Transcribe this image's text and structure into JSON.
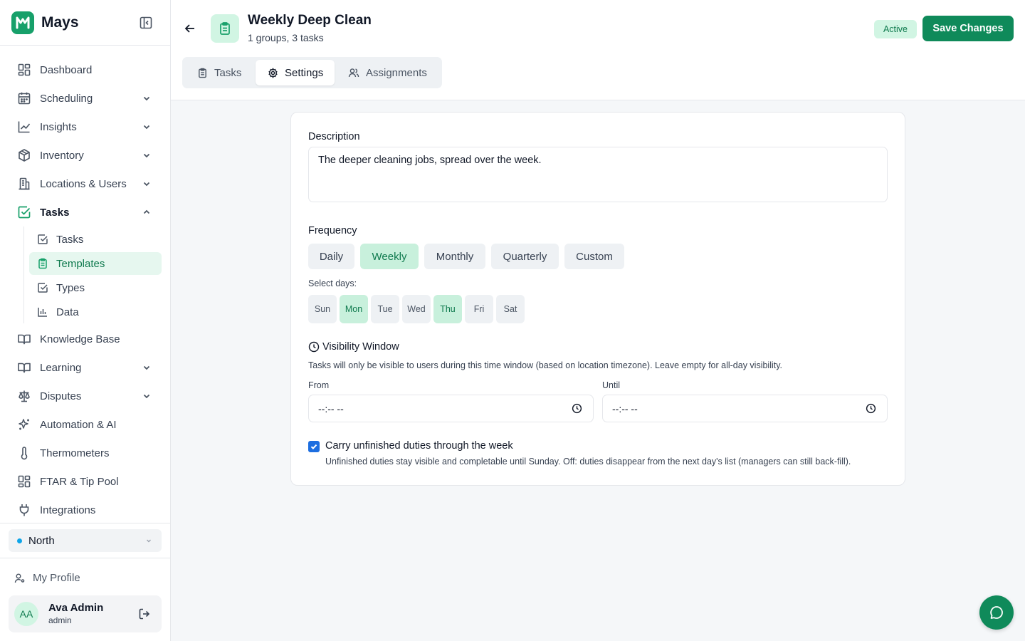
{
  "brand": {
    "name": "Mays"
  },
  "sidebar": {
    "items": [
      {
        "label": "Dashboard",
        "icon": "dashboard-icon"
      },
      {
        "label": "Scheduling",
        "icon": "calendar-icon"
      },
      {
        "label": "Insights",
        "icon": "line-chart-icon"
      },
      {
        "label": "Inventory",
        "icon": "box-icon"
      },
      {
        "label": "Locations & Users",
        "icon": "building-icon"
      },
      {
        "label": "Tasks",
        "icon": "check-square-icon"
      },
      {
        "label": "Knowledge Base",
        "icon": "book-icon"
      },
      {
        "label": "Learning",
        "icon": "book-icon"
      },
      {
        "label": "Disputes",
        "icon": "scale-icon"
      },
      {
        "label": "Automation & AI",
        "icon": "sparkles-icon"
      },
      {
        "label": "Thermometers",
        "icon": "thermometer-icon"
      },
      {
        "label": "FTAR & Tip Pool",
        "icon": "dashboard-icon"
      },
      {
        "label": "Integrations",
        "icon": "plug-icon"
      }
    ],
    "task_subitems": [
      {
        "label": "Tasks"
      },
      {
        "label": "Templates"
      },
      {
        "label": "Types"
      },
      {
        "label": "Data"
      }
    ],
    "location": "North",
    "my_profile": "My Profile",
    "user": {
      "initials": "AA",
      "name": "Ava Admin",
      "role": "admin"
    }
  },
  "header": {
    "title": "Weekly Deep Clean",
    "subtitle": "1 groups, 3 tasks",
    "status": "Active",
    "save_label": "Save Changes",
    "tabs": [
      {
        "label": "Tasks"
      },
      {
        "label": "Settings"
      },
      {
        "label": "Assignments"
      }
    ]
  },
  "settings": {
    "description_label": "Description",
    "description_value": "The deeper cleaning jobs, spread over the week.",
    "frequency_label": "Frequency",
    "frequency_options": [
      "Daily",
      "Weekly",
      "Monthly",
      "Quarterly",
      "Custom"
    ],
    "frequency_selected": "Weekly",
    "select_days_label": "Select days:",
    "days": [
      "Sun",
      "Mon",
      "Tue",
      "Wed",
      "Thu",
      "Fri",
      "Sat"
    ],
    "days_selected": [
      "Mon",
      "Thu"
    ],
    "visibility_title": "Visibility Window",
    "visibility_desc": "Tasks will only be visible to users during this time window (based on location timezone). Leave empty for all-day visibility.",
    "from_label": "From",
    "until_label": "Until",
    "time_placeholder": "--:-- --",
    "carry_checked": true,
    "carry_label": "Carry unfinished duties through the week",
    "carry_desc": "Unfinished duties stay visible and completable until Sunday. Off: duties disappear from the next day's list (managers can still back-fill)."
  },
  "colors": {
    "accent": "#0f8a5a",
    "accent_soft": "#c8f0dc",
    "checkbox": "#1d6ee0"
  }
}
